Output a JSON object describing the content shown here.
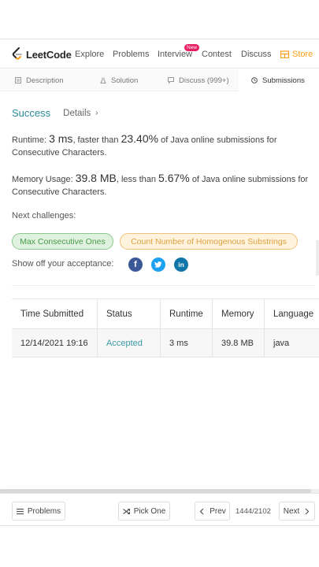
{
  "nav": {
    "logo_text": "LeetCode",
    "items": [
      "Explore",
      "Problems",
      "Interview",
      "Contest",
      "Discuss"
    ],
    "new_badge": "New",
    "store_label": "Store"
  },
  "tabs": [
    {
      "label": "Description",
      "icon": "document-icon"
    },
    {
      "label": "Solution",
      "icon": "flask-icon"
    },
    {
      "label": "Discuss (999+)",
      "icon": "chat-icon"
    },
    {
      "label": "Submissions",
      "icon": "clock-icon",
      "active": true
    }
  ],
  "result": {
    "status": "Success",
    "details_label": "Details",
    "details_chevron": "›",
    "runtime_label": "Runtime:",
    "runtime_value": "3 ms",
    "runtime_mid": ", faster than",
    "runtime_pct": "23.40%",
    "runtime_suffix": "of Java online submissions for Consecutive Characters.",
    "memory_label": "Memory Usage:",
    "memory_value": "39.8 MB",
    "memory_mid": ", less than",
    "memory_pct": "5.67%",
    "memory_suffix": "of Java online submissions for Consecutive Characters."
  },
  "next_challenges": {
    "label": "Next challenges:",
    "items": [
      "Max Consecutive Ones",
      "Count Number of Homogenous Substrings"
    ]
  },
  "share": {
    "label": "Show off your acceptance:",
    "icons": [
      "facebook-icon",
      "twitter-icon",
      "linkedin-icon"
    ],
    "fb_glyph": "f",
    "li_glyph": "in"
  },
  "table": {
    "headers": [
      "Time Submitted",
      "Status",
      "Runtime",
      "Memory",
      "Language"
    ],
    "rows": [
      [
        "12/14/2021 19:16",
        "Accepted",
        "3 ms",
        "39.8 MB",
        "java"
      ]
    ]
  },
  "footer": {
    "problems_label": "Problems",
    "pick_one_label": "Pick One",
    "prev_label": "Prev",
    "page_count": "1444/2102",
    "next_label": "Next"
  },
  "colors": {
    "accent_teal": "#2d8a9a",
    "store_orange": "#ffa116",
    "new_badge": "#e91e63",
    "chip_green": "#dff2df",
    "chip_orange": "#fff3dd"
  }
}
